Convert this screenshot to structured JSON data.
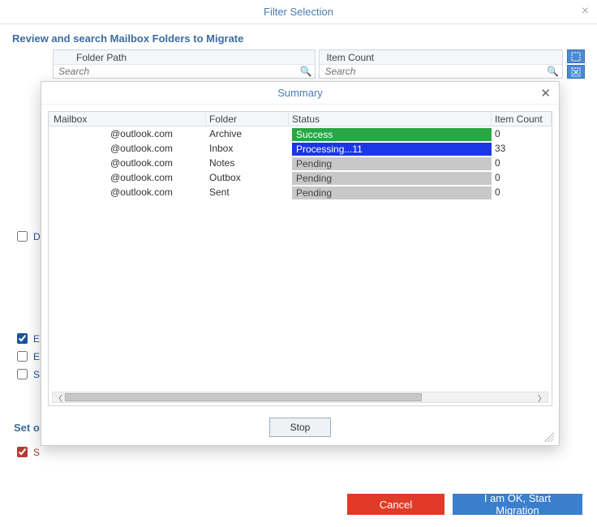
{
  "main": {
    "title": "Filter Selection",
    "subtitle": "Review and search Mailbox Folders to Migrate",
    "col1_header": "Folder Path",
    "col2_header": "Item Count",
    "search_placeholder": "Search",
    "hidden_checkbox_d": "D",
    "hidden_checkbox_e1": "E",
    "hidden_checkbox_e2": "E",
    "hidden_checkbox_s": "S",
    "set_heading": "Set o",
    "hidden_checkbox_s2": "S"
  },
  "footer": {
    "cancel": "Cancel",
    "start": "I am OK, Start Migration"
  },
  "dialog": {
    "title": "Summary",
    "columns": {
      "mailbox": "Mailbox",
      "folder": "Folder",
      "status": "Status",
      "item_count": "Item Count"
    },
    "rows": [
      {
        "mailbox": "@outlook.com",
        "folder": "Archive",
        "status_text": "Success",
        "status_class": "status-success",
        "count": "0"
      },
      {
        "mailbox": "@outlook.com",
        "folder": "Inbox",
        "status_text": "Processing...11",
        "status_class": "status-processing",
        "count": "33"
      },
      {
        "mailbox": "@outlook.com",
        "folder": "Notes",
        "status_text": "Pending",
        "status_class": "status-pending",
        "count": "0"
      },
      {
        "mailbox": "@outlook.com",
        "folder": "Outbox",
        "status_text": "Pending",
        "status_class": "status-pending",
        "count": "0"
      },
      {
        "mailbox": "@outlook.com",
        "folder": "Sent",
        "status_text": "Pending",
        "status_class": "status-pending",
        "count": "0"
      }
    ],
    "stop": "Stop"
  }
}
